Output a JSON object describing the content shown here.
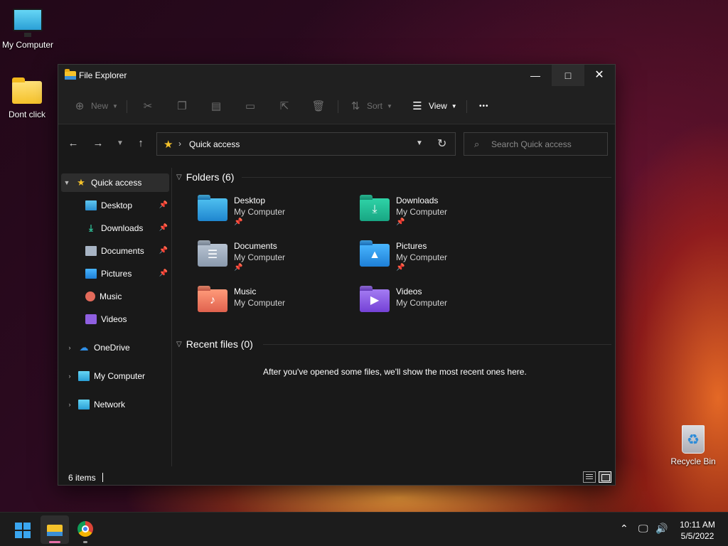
{
  "desktop": {
    "icons": [
      {
        "label": "My Computer"
      },
      {
        "label": "Dont click"
      },
      {
        "label": "Recycle Bin"
      }
    ]
  },
  "window": {
    "title": "File Explorer",
    "controls": {
      "minimize": "—",
      "maximize": "□",
      "close": "✕"
    }
  },
  "toolbar": {
    "new_label": "New",
    "sort_label": "Sort",
    "view_label": "View",
    "more_label": "•••"
  },
  "address": {
    "path": "Quick access",
    "search_placeholder": "Search Quick access"
  },
  "sidebar": {
    "items": [
      {
        "label": "Quick access",
        "icon": "star-icon"
      },
      {
        "label": "Desktop",
        "icon": "desktop-icon",
        "pinned": true
      },
      {
        "label": "Downloads",
        "icon": "downloads-icon",
        "pinned": true
      },
      {
        "label": "Documents",
        "icon": "documents-icon",
        "pinned": true
      },
      {
        "label": "Pictures",
        "icon": "pictures-icon",
        "pinned": true
      },
      {
        "label": "Music",
        "icon": "music-icon"
      },
      {
        "label": "Videos",
        "icon": "videos-icon"
      },
      {
        "label": "OneDrive",
        "icon": "onedrive-icon"
      },
      {
        "label": "My Computer",
        "icon": "computer-icon"
      },
      {
        "label": "Network",
        "icon": "network-icon"
      }
    ]
  },
  "main": {
    "folders_header": "Folders (6)",
    "folders": [
      {
        "name": "Desktop",
        "location": "My Computer",
        "pinned": true
      },
      {
        "name": "Downloads",
        "location": "My Computer",
        "pinned": true
      },
      {
        "name": "Documents",
        "location": "My Computer",
        "pinned": true
      },
      {
        "name": "Pictures",
        "location": "My Computer",
        "pinned": true
      },
      {
        "name": "Music",
        "location": "My Computer",
        "pinned": false
      },
      {
        "name": "Videos",
        "location": "My Computer",
        "pinned": false
      }
    ],
    "recent_header": "Recent files (0)",
    "recent_empty": "After you've opened some files, we'll show the most recent ones here."
  },
  "status": {
    "item_count": "6 items"
  },
  "taskbar": {
    "time": "10:11 AM",
    "date": "5/5/2022"
  },
  "colors": {
    "accent": "#3aa6f0",
    "quick_access_star": "#f5c22a",
    "window_bg": "#191919"
  }
}
